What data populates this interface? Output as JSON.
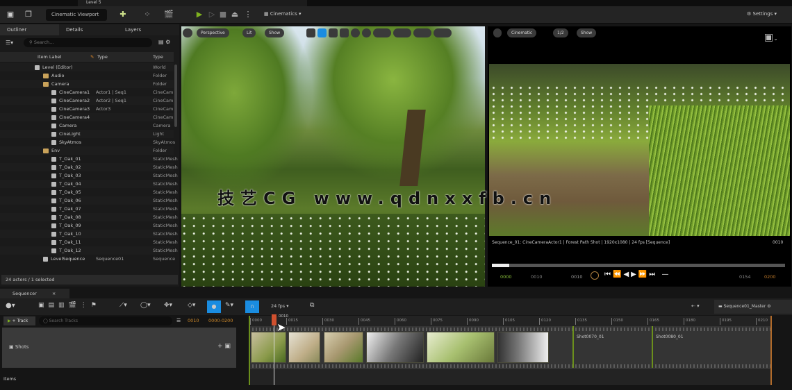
{
  "window": {
    "tab_title": "Level 5"
  },
  "toolbar": {
    "platform_label": "Cinematic Viewport",
    "modes": [
      "Add",
      "Blueprint",
      "Cinematics"
    ],
    "play": "play-icon",
    "settings_label": "Settings"
  },
  "outliner": {
    "tabs": [
      "Outliner",
      "Details",
      "Layers"
    ],
    "search_placeholder": "Search...",
    "columns": [
      "Item Label",
      "Type",
      "Type"
    ],
    "rows": [
      {
        "label": "Level (Editor)",
        "type": "World",
        "indent": 50,
        "icon": "level"
      },
      {
        "label": "Audio",
        "type": "Folder",
        "indent": 62,
        "icon": "folder"
      },
      {
        "label": "Camera",
        "type": "Folder",
        "indent": 62,
        "icon": "folder"
      },
      {
        "label": "CineCamera1",
        "extra": "Actor1 | Seq1",
        "type": "CineCam",
        "indent": 74,
        "icon": "actor"
      },
      {
        "label": "CineCamera2",
        "extra": "Actor2 | Seq1",
        "type": "CineCam",
        "indent": 74,
        "icon": "actor"
      },
      {
        "label": "CineCamera3",
        "extra": "Actor3",
        "type": "CineCam",
        "indent": 74,
        "icon": "actor"
      },
      {
        "label": "CineCamera4",
        "type": "CineCam",
        "indent": 74,
        "icon": "actor"
      },
      {
        "label": "Camera",
        "type": "Camera",
        "indent": 74,
        "icon": "actor"
      },
      {
        "label": "CineLight",
        "type": "Light",
        "indent": 74,
        "icon": "actor"
      },
      {
        "label": "SkyAtmos",
        "type": "SkyAtmos",
        "indent": 74,
        "icon": "actor"
      },
      {
        "label": "Env",
        "type": "Folder",
        "indent": 62,
        "icon": "folder"
      },
      {
        "label": "T_Oak_01",
        "type": "StaticMesh",
        "indent": 74,
        "icon": "actor"
      },
      {
        "label": "T_Oak_02",
        "type": "StaticMesh",
        "indent": 74,
        "icon": "actor"
      },
      {
        "label": "T_Oak_03",
        "type": "StaticMesh",
        "indent": 74,
        "icon": "actor"
      },
      {
        "label": "T_Oak_04",
        "type": "StaticMesh",
        "indent": 74,
        "icon": "actor"
      },
      {
        "label": "T_Oak_05",
        "type": "StaticMesh",
        "indent": 74,
        "icon": "actor"
      },
      {
        "label": "T_Oak_06",
        "type": "StaticMesh",
        "indent": 74,
        "icon": "actor"
      },
      {
        "label": "T_Oak_07",
        "type": "StaticMesh",
        "indent": 74,
        "icon": "actor"
      },
      {
        "label": "T_Oak_08",
        "type": "StaticMesh",
        "indent": 74,
        "icon": "actor"
      },
      {
        "label": "T_Oak_09",
        "type": "StaticMesh",
        "indent": 74,
        "icon": "actor"
      },
      {
        "label": "T_Oak_10",
        "type": "StaticMesh",
        "indent": 74,
        "icon": "actor"
      },
      {
        "label": "T_Oak_11",
        "type": "StaticMesh",
        "indent": 74,
        "icon": "actor"
      },
      {
        "label": "T_Oak_12",
        "type": "StaticMesh",
        "indent": 74,
        "icon": "actor"
      },
      {
        "label": "LevelSequence",
        "extra": "Sequence01",
        "type": "Sequence",
        "indent": 62,
        "icon": "actor"
      }
    ],
    "status": "24 actors / 1 selected"
  },
  "viewport": {
    "buttons": [
      "Perspective",
      "Lit",
      "Show"
    ]
  },
  "cine_viewport": {
    "buttons": [
      "Cinematic",
      "1/2",
      "Show"
    ],
    "caption": "Sequence_01: CineCameraActor1 | Forest Path Shot | 1920x1080 | 24 fps [Sequence]",
    "frame_readout": "0010",
    "start": "0000",
    "in": "0010",
    "current": "0010",
    "out": "0154",
    "end": "0200",
    "progress": 0.06,
    "aspect_label": "Aspect"
  },
  "watermark": {
    "text": "技艺CG  www.qdnxxfb.cn"
  },
  "sequencer": {
    "tab_title": "Sequencer",
    "fps_label": "24 fps",
    "track_button": "+ Track",
    "search_placeholder": "Search Tracks",
    "frame_current": "0010",
    "frame_range": "0000-0200",
    "track_label": "Shots",
    "footer_label": "Items",
    "right_label": "Sequence01_Master",
    "playhead_label": "0010",
    "ticks": [
      "0000",
      "0015",
      "0030",
      "0045",
      "0060",
      "0075",
      "0090",
      "0105",
      "0120",
      "0135",
      "0150",
      "0165",
      "0180",
      "0195",
      "0210"
    ],
    "empty_shots": [
      "Shot0070_01",
      "Shot0080_01"
    ]
  },
  "colors": {
    "accent": "#1a8ce0",
    "play": "#7fb21f",
    "playhead": "#d0502e",
    "shot_divider": "#6b8f1c"
  }
}
